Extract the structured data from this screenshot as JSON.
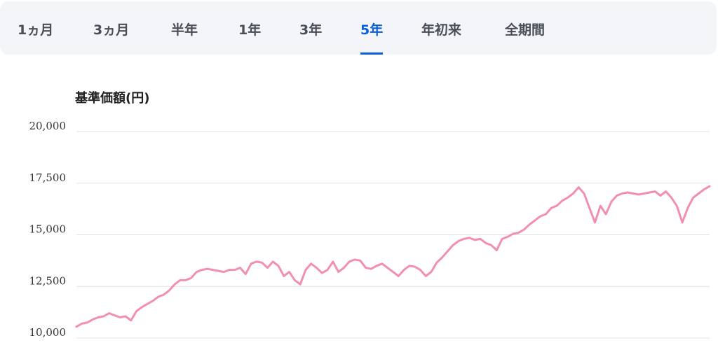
{
  "tabs": [
    {
      "label": "1ヵ月"
    },
    {
      "label": "3ヵ月"
    },
    {
      "label": "半年"
    },
    {
      "label": "1年"
    },
    {
      "label": "3年"
    },
    {
      "label": "5年"
    },
    {
      "label": "年初来"
    },
    {
      "label": "全期間"
    }
  ],
  "selected_tab": "5年",
  "colors": {
    "accent": "#0b5fd6",
    "line": "#f28fb1",
    "grid": "#dfe2e6"
  },
  "chart_data": {
    "type": "line",
    "title": "",
    "ylabel": "基準価額(円)",
    "xlabel": "",
    "ylim": [
      10000,
      20000
    ],
    "yticks": [
      10000,
      12500,
      15000,
      17500,
      20000
    ],
    "ytick_labels": [
      "10,000",
      "12,500",
      "15,000",
      "17,500",
      "20,000"
    ],
    "grid": true,
    "legend": "none",
    "series": [
      {
        "values": [
          10550,
          10700,
          10750,
          10900,
          11000,
          11050,
          11200,
          11100,
          11000,
          11050,
          10850,
          11300,
          11500,
          11650,
          11800,
          12000,
          12100,
          12300,
          12600,
          12800,
          12800,
          12900,
          13200,
          13300,
          13350,
          13300,
          13250,
          13200,
          13300,
          13300,
          13400,
          13100,
          13600,
          13700,
          13650,
          13400,
          13700,
          13500,
          13000,
          13200,
          12800,
          12600,
          13300,
          13600,
          13400,
          13150,
          13300,
          13700,
          13200,
          13400,
          13700,
          13800,
          13750,
          13400,
          13350,
          13500,
          13600,
          13400,
          13200,
          13000,
          13300,
          13500,
          13450,
          13300,
          13000,
          13200,
          13650,
          13900,
          14200,
          14500,
          14700,
          14800,
          14850,
          14750,
          14800,
          14600,
          14500,
          14250,
          14800,
          14900,
          15050,
          15100,
          15250,
          15500,
          15700,
          15900,
          16000,
          16300,
          16400,
          16650,
          16800,
          17000,
          17300,
          17000,
          16300,
          15600,
          16400,
          16000,
          16600,
          16900,
          17000,
          17050,
          17000,
          16950,
          17000,
          17050,
          17100,
          16900,
          17100,
          16800,
          16400,
          15600,
          16300,
          16800,
          17000,
          17200,
          17350
        ]
      }
    ]
  }
}
